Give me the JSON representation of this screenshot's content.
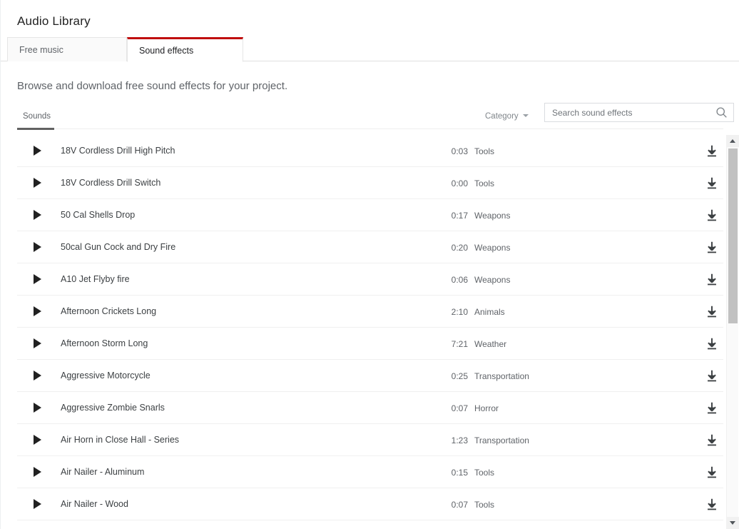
{
  "header": {
    "title": "Audio Library"
  },
  "tabs": [
    {
      "label": "Free music",
      "active": false
    },
    {
      "label": "Sound effects",
      "active": true
    }
  ],
  "description": "Browse and download free sound effects for your project.",
  "list_header": {
    "sounds_label": "Sounds",
    "category_filter_label": "Category",
    "caret_icon": "chevron-down-icon"
  },
  "search": {
    "placeholder": "Search sound effects",
    "value": "",
    "icon": "search-icon"
  },
  "accent_color": "#c00d0d",
  "rows": [
    {
      "title": "18V Cordless Drill High Pitch",
      "duration": "0:03",
      "category": "Tools"
    },
    {
      "title": "18V Cordless Drill Switch",
      "duration": "0:00",
      "category": "Tools"
    },
    {
      "title": "50 Cal Shells Drop",
      "duration": "0:17",
      "category": "Weapons"
    },
    {
      "title": "50cal Gun Cock and Dry Fire",
      "duration": "0:20",
      "category": "Weapons"
    },
    {
      "title": "A10 Jet Flyby fire",
      "duration": "0:06",
      "category": "Weapons"
    },
    {
      "title": "Afternoon Crickets Long",
      "duration": "2:10",
      "category": "Animals"
    },
    {
      "title": "Afternoon Storm Long",
      "duration": "7:21",
      "category": "Weather"
    },
    {
      "title": "Aggressive Motorcycle",
      "duration": "0:25",
      "category": "Transportation"
    },
    {
      "title": "Aggressive Zombie Snarls",
      "duration": "0:07",
      "category": "Horror"
    },
    {
      "title": "Air Horn in Close Hall - Series",
      "duration": "1:23",
      "category": "Transportation"
    },
    {
      "title": "Air Nailer - Aluminum",
      "duration": "0:15",
      "category": "Tools"
    },
    {
      "title": "Air Nailer - Wood",
      "duration": "0:07",
      "category": "Tools"
    }
  ],
  "row_icons": {
    "play": "play-icon",
    "download": "download-icon"
  },
  "scrollbar": {
    "up_icon": "scroll-up-arrow-icon",
    "down_icon": "scroll-down-arrow-icon"
  }
}
